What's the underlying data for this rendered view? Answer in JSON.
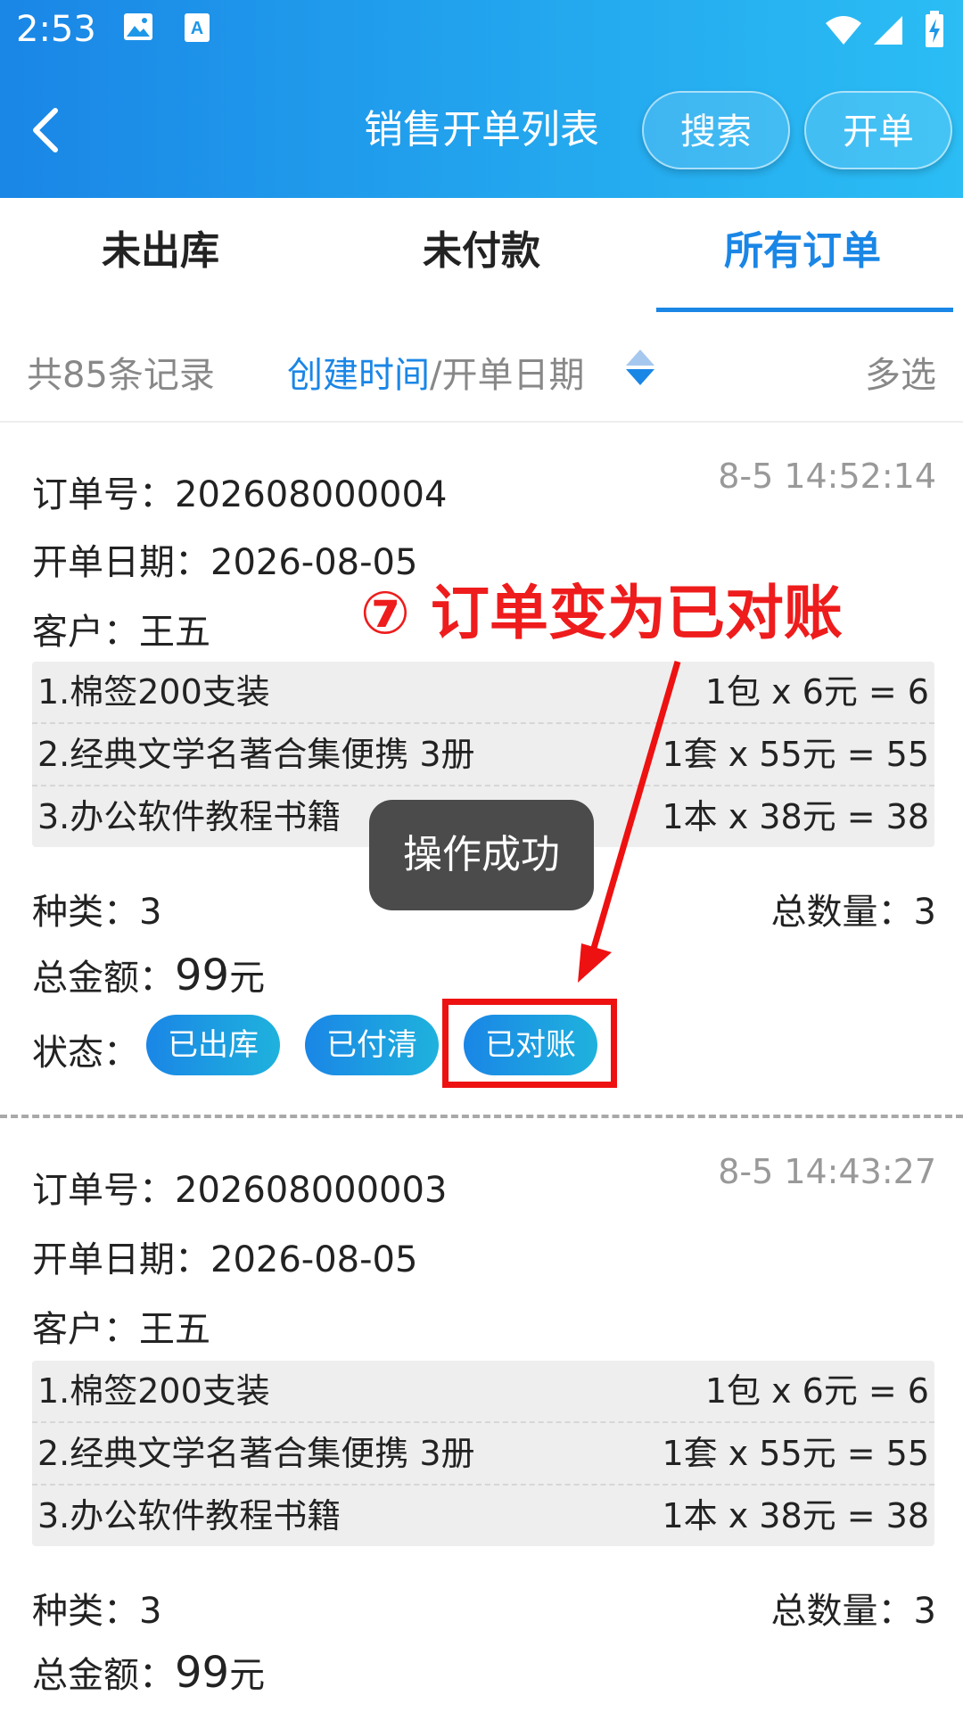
{
  "status_bar": {
    "time": "2:53"
  },
  "header": {
    "title": "销售开单列表",
    "search_label": "搜索",
    "create_label": "开单"
  },
  "tabs": [
    {
      "label": "未出库",
      "active": false
    },
    {
      "label": "未付款",
      "active": false
    },
    {
      "label": "所有订单",
      "active": true
    }
  ],
  "sortbar": {
    "records": "共85条记录",
    "sort_primary": "创建时间",
    "sort_secondary": "/开单日期",
    "multi_select": "多选"
  },
  "orders": [
    {
      "order_no": "订单号：202608000004",
      "time": "8-5 14:52:14",
      "date": "开单日期：2026-08-05",
      "customer": "客户：王五",
      "items": [
        {
          "name": "1.棉签200支装",
          "price": "1包 x 6元 = 6"
        },
        {
          "name": "2.经典文学名著合集便携 3册",
          "price": "1套 x 55元 = 55"
        },
        {
          "name": "3.办公软件教程书籍",
          "price": "1本 x 38元 = 38"
        }
      ],
      "kinds": "种类：3",
      "total_qty": "总数量：3",
      "amount_label": "总金额：",
      "amount_value": "99",
      "amount_unit": "元",
      "status_label": "状态：",
      "statuses": [
        "已出库",
        "已付清",
        "已对账"
      ]
    },
    {
      "order_no": "订单号：202608000003",
      "time": "8-5 14:43:27",
      "date": "开单日期：2026-08-05",
      "customer": "客户：王五",
      "items": [
        {
          "name": "1.棉签200支装",
          "price": "1包 x 6元 = 6"
        },
        {
          "name": "2.经典文学名著合集便携 3册",
          "price": "1套 x 55元 = 55"
        },
        {
          "name": "3.办公软件教程书籍",
          "price": "1本 x 38元 = 38"
        }
      ],
      "kinds": "种类：3",
      "total_qty": "总数量：3",
      "amount_label": "总金额：",
      "amount_value": "99",
      "amount_unit": "元"
    }
  ],
  "toast": "操作成功",
  "annotation": "⑦ 订单变为已对账",
  "colors": {
    "accent": "#1a86e6",
    "annotation_red": "#ee1c1c",
    "toast_bg": "#4b4b4b"
  }
}
